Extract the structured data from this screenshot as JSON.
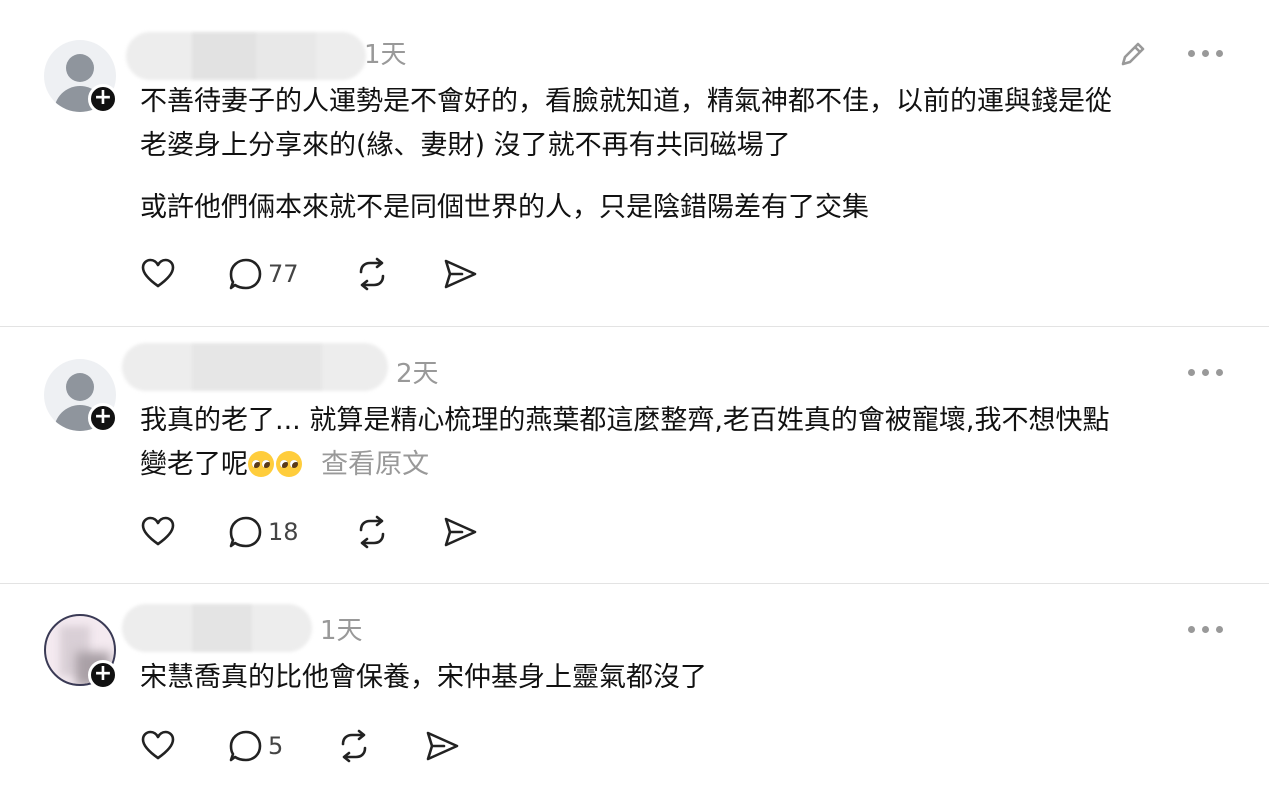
{
  "posts": [
    {
      "time": "1天",
      "paragraphs": [
        "不善待妻子的人運勢是不會好的，看臉就知道，精氣神都不佳，以前的運與錢是從\n老婆身上分享來的(緣、妻財) 沒了就不再有共同磁場了",
        "或許他們倆本來就不是同個世界的人，只是陰錯陽差有了交集"
      ],
      "reply_count": "77",
      "has_edit": true
    },
    {
      "time": "2天",
      "paragraphs": [
        "我真的老了... 就算是精心梳理的燕葉都這麼整齊,老百姓真的會被寵壞,我不想快點\n變老了呢"
      ],
      "view_original": "查看原文",
      "reply_count": "18"
    },
    {
      "time": "1天",
      "paragraphs": [
        "宋慧喬真的比他會保養，宋仲基身上靈氣都沒了"
      ],
      "reply_count": "5"
    }
  ],
  "icons": {
    "like": "heart-icon",
    "reply": "comment-icon",
    "repost": "repost-icon",
    "share": "send-icon",
    "edit": "pencil-icon",
    "more": "more-icon",
    "follow": "plus-icon"
  },
  "colors": {
    "text": "#111111",
    "muted": "#999999",
    "divider": "#e3e3e3",
    "avatar_placeholder": "#8f959d"
  }
}
